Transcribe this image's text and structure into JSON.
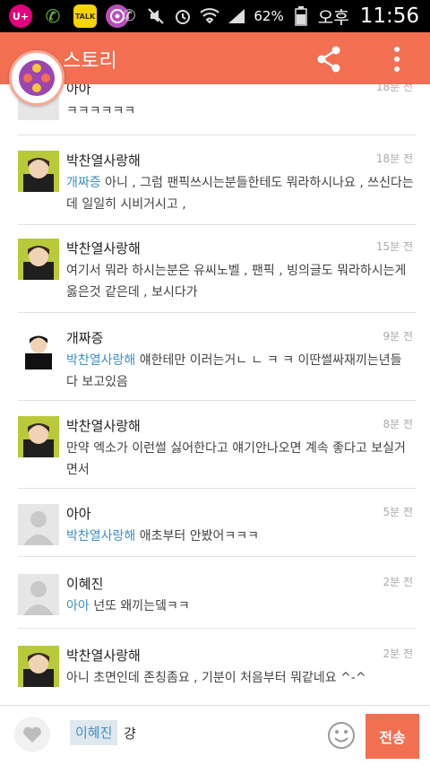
{
  "status_bar": {
    "carrier_badge": "U+",
    "battery": "62%",
    "ampm": "오후",
    "time": "11:56"
  },
  "app_bar": {
    "title": "스토리"
  },
  "comments": [
    {
      "author": "아아",
      "time": "18분 전",
      "text": "ㅋㅋㅋㅋㅋㅋ",
      "mention": "",
      "avatar": "gray"
    },
    {
      "author": "박찬열사랑해",
      "time": "18분 전",
      "mention": "개짜증",
      "text": " 아니 , 그럼 팬픽쓰시는분들한테도 뭐라하시나요 , 쓰신다는데 일일히 시비거시고 ,",
      "avatar": "photo"
    },
    {
      "author": "박찬열사랑해",
      "time": "15분 전",
      "mention": "",
      "text": "여기서 뭐라 하시는분은 유씨노벨 , 팬픽 , 빙의글도 뭐라하시는게 옳은것 같은데 , 보시다가",
      "avatar": "photo"
    },
    {
      "author": "개짜증",
      "time": "9분 전",
      "mention": "박찬열사랑해",
      "text": " 얘한테만 이러는거ㄴ ㄴ ㅋ ㅋ 이딴썰싸재끼는년들 다 보고있음",
      "avatar": "photo2"
    },
    {
      "author": "박찬열사랑해",
      "time": "8분 전",
      "mention": "",
      "text": "만약 엑소가 이런썰 싫어한다고 얘기안나오면 계속 좋다고 보실거면서",
      "avatar": "photo"
    },
    {
      "author": "아아",
      "time": "5분 전",
      "mention": "박찬열사랑해",
      "text": " 애초부터 안봤어ㅋㅋㅋ",
      "avatar": "gray"
    },
    {
      "author": "이혜진",
      "time": "2분 전",
      "mention": "아아",
      "text": " 넌또 왜끼는뎈ㅋㅋ",
      "avatar": "gray"
    },
    {
      "author": "박찬열사랑해",
      "time": "2분 전",
      "mention": "",
      "text": "아니 초면인데 존칭좀요 , 기분이 처음부터 뭐같네요 ^-^",
      "avatar": "photo"
    }
  ],
  "input": {
    "tag": "이혜진",
    "value": "걍",
    "send_label": "전송"
  },
  "colors": {
    "accent": "#f26f52",
    "mention": "#3f8fc2"
  }
}
